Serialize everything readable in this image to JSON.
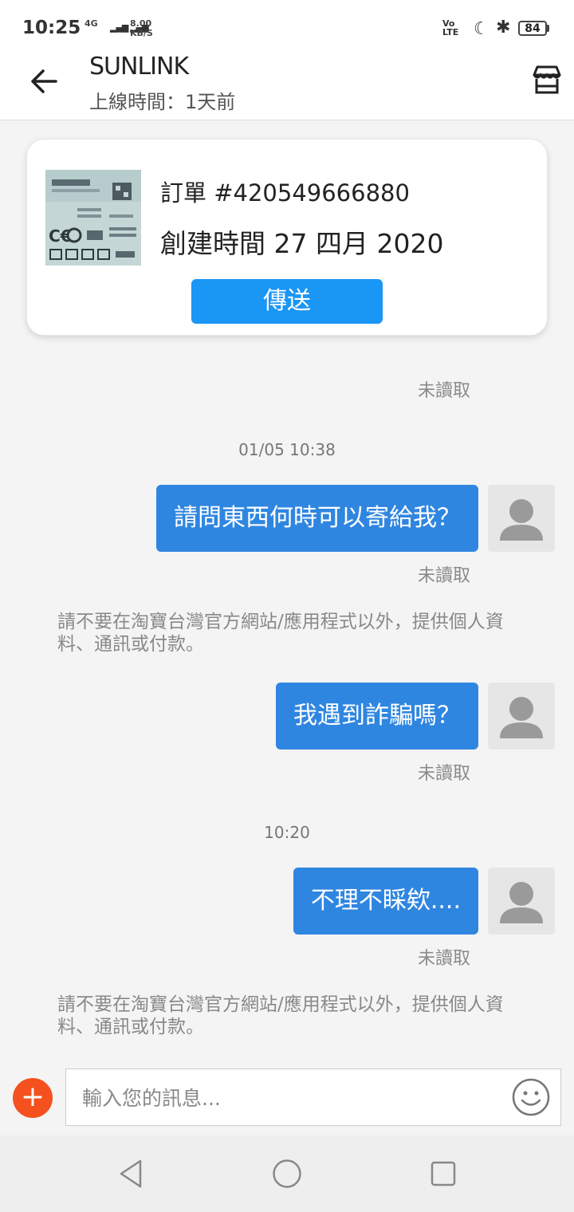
{
  "status_bar": {
    "time": "10:25",
    "network": "4G",
    "speed_value": "8.00",
    "speed_unit": "KB/S",
    "volte": "Vo LTE",
    "battery": "84"
  },
  "header": {
    "shop_name": "SUNLINK",
    "online_status": "上線時間：1天前"
  },
  "order_card": {
    "order_number": "訂單 #420549666880",
    "created": "創建時間 27 四月 2020",
    "send_label": "傳送"
  },
  "messages": {
    "read_status": "未讀取",
    "timestamp_1": "01/05 10:38",
    "msg_1": "請問東西何時可以寄給我？",
    "notice": "請不要在淘寶台灣官方網站/應用程式以外，提供個人資料、通訊或付款。",
    "msg_2": "我遇到詐騙嗎？",
    "timestamp_2": "10:20",
    "msg_3": "不理不睬欸...."
  },
  "input": {
    "placeholder": "輸入您的訊息..."
  },
  "colors": {
    "bubble": "#2f86e0",
    "send_button": "#1a96f5",
    "plus_button": "#f4511e"
  }
}
